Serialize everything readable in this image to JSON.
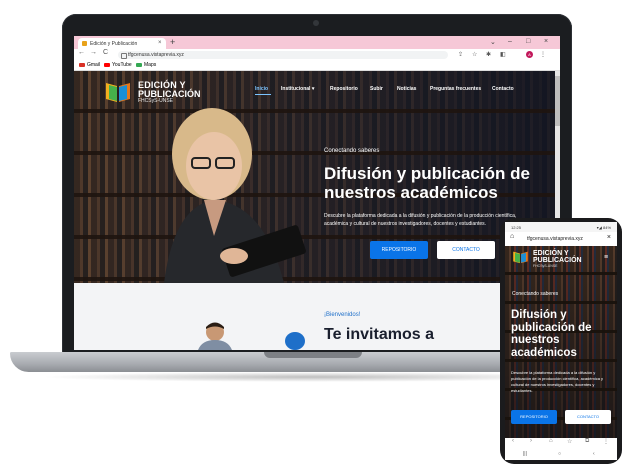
{
  "browser": {
    "tab_title": "Edición y Publicación",
    "tab_close": "×",
    "new_tab": "+",
    "url": "tfgcenusa.vistaprevia.xyz",
    "bookmarks": [
      "Gmail",
      "YouTube",
      "Maps"
    ],
    "avatar_letter": "A",
    "win_min": "–",
    "win_max": "□",
    "win_close": "×",
    "tab_list": "⌄",
    "nav_back": "←",
    "nav_forward": "→",
    "nav_reload": "C",
    "share": "⇪",
    "star": "☆",
    "extensions": "✱",
    "sidebar": "◧",
    "kebab": "⋮"
  },
  "site": {
    "logo_line1": "EDICIÓN Y",
    "logo_line2": "PUBLICACIÓN",
    "logo_line3": "FHCSyS-UNSE",
    "nav": [
      "Inicio",
      "Institucional ▾",
      "Repositorio",
      "Subir",
      "Noticias",
      "Preguntas frecuentes",
      "Contacto"
    ],
    "hero_eyebrow": "Conectando saberes",
    "hero_title": "Difusión y publicación de nuestros académicos",
    "hero_desc": "Descubre la plataforma dedicada a la difusión y publicación de la producción científica, académica y cultural de nuestros investigadores, docentes y estudiantes.",
    "btn_primary": "REPOSITORIO",
    "btn_secondary": "CONTACTO",
    "section_eyebrow": "¡Bienvenidos!",
    "section_title": "Te invitamos a"
  },
  "phone": {
    "status_time": "12:25",
    "status_right": "▾◢ 84%",
    "url": "tfgcenusa.vistaprevia.xyz",
    "close": "×",
    "home": "⌂",
    "menu_icon": "≡",
    "hero_eyebrow": "Conectando saberes",
    "hero_title": "Difusión y publicación de nuestros académicos",
    "hero_desc": "Descubre la plataforma dedicada a la difusión y publicación de la producción científica, académica y cultural de nuestros investigadores, docentes y estudiantes.",
    "btn_primary": "REPOSITORIO",
    "btn_secondary": "CONTACTO",
    "bottom_bar": [
      "‹",
      "›",
      "⌂",
      "☆",
      "⧉",
      "⋮"
    ],
    "system_nav": [
      "|||",
      "○",
      "‹"
    ]
  },
  "colors": {
    "accent_blue": "#0a74e8",
    "tab_bar_pink": "#f6c8d7",
    "hero_dark": "#1a1f2e"
  }
}
